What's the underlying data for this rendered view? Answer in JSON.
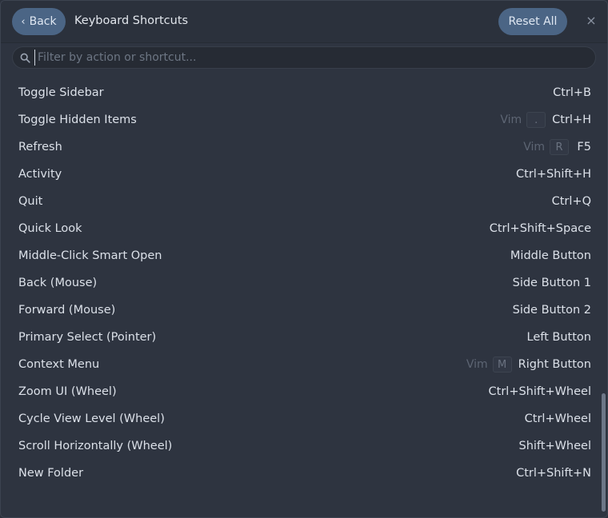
{
  "header": {
    "back_label": "Back",
    "back_chevron": "‹",
    "title": "Keyboard Shortcuts",
    "reset_label": "Reset All",
    "close_glyph": "×"
  },
  "search": {
    "placeholder": "Filter by action or shortcut...",
    "value": ""
  },
  "shortcuts": [
    {
      "action": "Toggle Sidebar",
      "vim_label": "",
      "vim_key": "",
      "shortcut": "Ctrl+B"
    },
    {
      "action": "Toggle Hidden Items",
      "vim_label": "Vim",
      "vim_key": ".",
      "shortcut": "Ctrl+H"
    },
    {
      "action": "Refresh",
      "vim_label": "Vim",
      "vim_key": "R",
      "shortcut": "F5"
    },
    {
      "action": "Activity",
      "vim_label": "",
      "vim_key": "",
      "shortcut": "Ctrl+Shift+H"
    },
    {
      "action": "Quit",
      "vim_label": "",
      "vim_key": "",
      "shortcut": "Ctrl+Q"
    },
    {
      "action": "Quick Look",
      "vim_label": "",
      "vim_key": "",
      "shortcut": "Ctrl+Shift+Space"
    },
    {
      "action": "Middle-Click Smart Open",
      "vim_label": "",
      "vim_key": "",
      "shortcut": "Middle Button"
    },
    {
      "action": "Back (Mouse)",
      "vim_label": "",
      "vim_key": "",
      "shortcut": "Side Button 1"
    },
    {
      "action": "Forward (Mouse)",
      "vim_label": "",
      "vim_key": "",
      "shortcut": "Side Button 2"
    },
    {
      "action": "Primary Select (Pointer)",
      "vim_label": "",
      "vim_key": "",
      "shortcut": "Left Button"
    },
    {
      "action": "Context Menu",
      "vim_label": "Vim",
      "vim_key": "M",
      "shortcut": "Right Button"
    },
    {
      "action": "Zoom UI (Wheel)",
      "vim_label": "",
      "vim_key": "",
      "shortcut": "Ctrl+Shift+Wheel"
    },
    {
      "action": "Cycle View Level (Wheel)",
      "vim_label": "",
      "vim_key": "",
      "shortcut": "Ctrl+Wheel"
    },
    {
      "action": "Scroll Horizontally (Wheel)",
      "vim_label": "",
      "vim_key": "",
      "shortcut": "Shift+Wheel"
    },
    {
      "action": "New Folder",
      "vim_label": "",
      "vim_key": "",
      "shortcut": "Ctrl+Shift+N"
    }
  ],
  "icons": {
    "search": "search-icon",
    "back": "chevron-left-icon",
    "close": "close-icon"
  },
  "colors": {
    "accent": "#4b6585",
    "background": "#2e3440",
    "text": "#dbe0e8",
    "muted": "#5d6573"
  }
}
